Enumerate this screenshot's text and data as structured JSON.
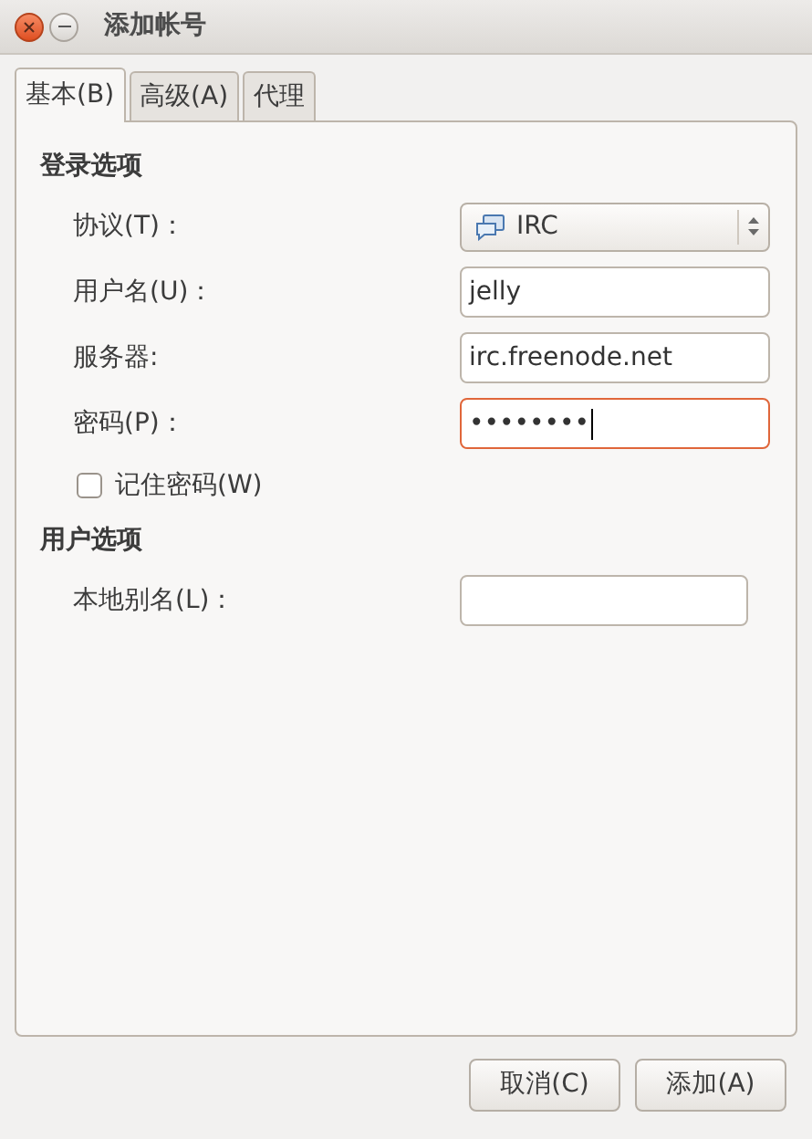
{
  "window": {
    "title": "添加帐号"
  },
  "tabs": [
    {
      "label": "基本(B)",
      "selected": true
    },
    {
      "label": "高级(A)",
      "selected": false
    },
    {
      "label": "代理",
      "selected": false
    }
  ],
  "login_section": {
    "title": "登录选项",
    "fields": [
      {
        "kind": "select",
        "label": "协议(T)：",
        "value": "IRC"
      },
      {
        "kind": "text",
        "label": "用户名(U)：",
        "value": "jelly",
        "focused": false
      },
      {
        "kind": "text",
        "label": "服务器:",
        "value": "irc.freenode.net",
        "focused": false
      },
      {
        "kind": "text",
        "label": "密码(P)：",
        "value": "••••••••",
        "focused": true
      }
    ],
    "remember": {
      "label": "记住密码(W)",
      "checked": false
    }
  },
  "user_section": {
    "title": "用户选项",
    "fields": [
      {
        "kind": "text",
        "label": "本地别名(L)：",
        "focused": false
      }
    ]
  },
  "buttons": [
    {
      "label": "取消(C)"
    },
    {
      "label": "添加(A)"
    }
  ]
}
